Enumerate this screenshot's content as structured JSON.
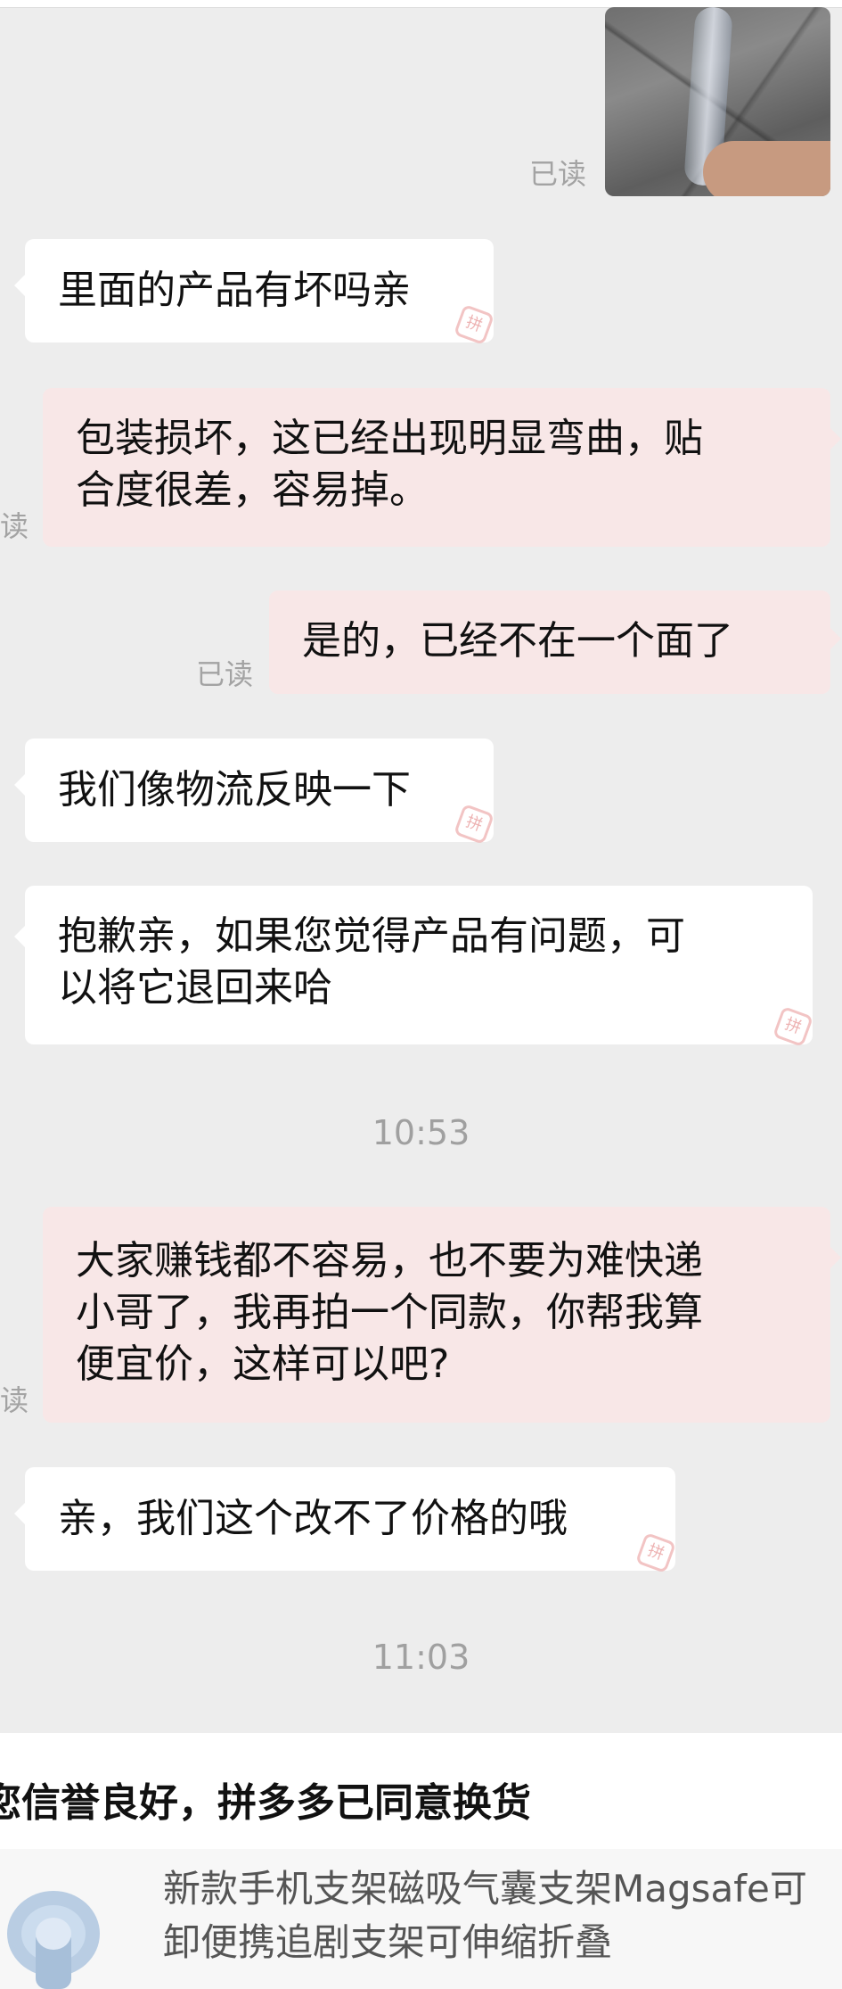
{
  "messages": [
    {
      "side": "right",
      "type": "image",
      "status": "已读"
    },
    {
      "side": "left",
      "text": "里面的产品有坏吗亲",
      "stamp": "拼"
    },
    {
      "side": "right",
      "text": "包装损坏，这已经出现明显弯曲，贴\n合度很差，容易掉。",
      "status": "读"
    },
    {
      "side": "right",
      "text": "是的，已经不在一个面了",
      "status": "已读"
    },
    {
      "side": "left",
      "text": "我们像物流反映一下",
      "stamp": "拼"
    },
    {
      "side": "left",
      "text": "抱歉亲，如果您觉得产品有问题，可\n以将它退回来哈",
      "stamp": "拼"
    },
    {
      "type": "time",
      "text": "10:53"
    },
    {
      "side": "right",
      "text": "大家赚钱都不容易，也不要为难快递\n小哥了，我再拍一个同款，你帮我算\n便宜价，这样可以吧?",
      "status": "读"
    },
    {
      "side": "left",
      "text": "亲，我们这个改不了价格的哦",
      "stamp": "拼"
    },
    {
      "type": "time",
      "text": "11:03"
    }
  ],
  "card": {
    "title": "您信誉良好，拼多多已同意换货",
    "product_name": "新款手机支架磁吸气囊支架Magsafe可\n卸便携追剧支架可伸缩折叠",
    "thumb_icon": "phone-holder-icon"
  },
  "colors": {
    "background": "#ededed",
    "left_bubble": "#ffffff",
    "right_bubble": "#f8e7e7",
    "meta_text": "#a3a3a3"
  }
}
